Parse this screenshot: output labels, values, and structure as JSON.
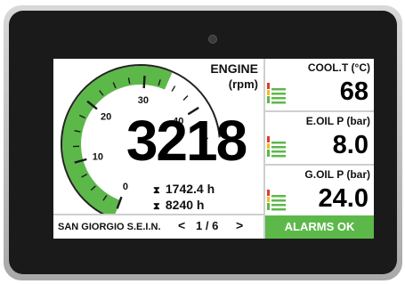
{
  "engine": {
    "title": "ENGINE",
    "unit": "(rpm)",
    "rpm": "3218",
    "hours1": "1742.4 h",
    "hours2": "8240 h",
    "gauge": {
      "tick_labels": [
        "0",
        "10",
        "20",
        "30",
        "40"
      ],
      "green_fraction": 0.75,
      "accent_color": "#5db84a"
    }
  },
  "panels": [
    {
      "label": "COOL.T (°C)",
      "value": "68",
      "icon": "bar-level-icon",
      "alert_color": "#e23a2e"
    },
    {
      "label": "E.OIL P (bar)",
      "value": "8.0",
      "icon": "bar-level-icon",
      "alert_color": "#e23a2e"
    },
    {
      "label": "G.OIL P (bar)",
      "value": "24.0",
      "icon": "bar-level-icon",
      "alert_color": "#e23a2e"
    }
  ],
  "footer": {
    "name": "SAN GIORGIO S.E.I.N.",
    "prev": "<",
    "page": "1 / 6",
    "next": ">",
    "alarm": "ALARMS OK",
    "alarm_color": "#5db84a"
  }
}
